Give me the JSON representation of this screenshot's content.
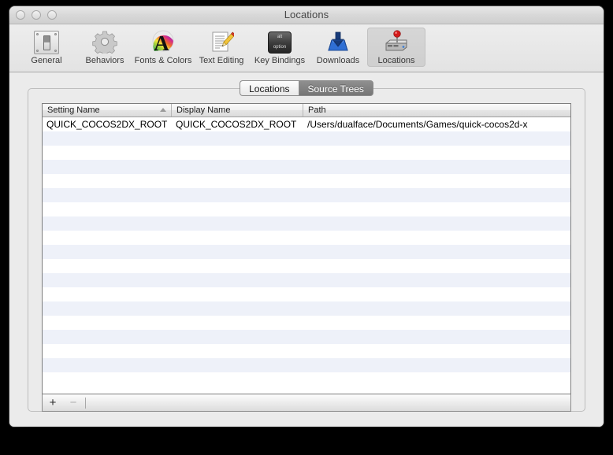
{
  "window": {
    "title": "Locations",
    "traffic_lights": [
      "close-button",
      "minimize-button",
      "zoom-button"
    ]
  },
  "toolbar": {
    "items": [
      {
        "label": "General",
        "icon": "toggle-switch-icon",
        "selected": false
      },
      {
        "label": "Behaviors",
        "icon": "gear-icon",
        "selected": false
      },
      {
        "label": "Fonts & Colors",
        "icon": "rainbow-letter-a-icon",
        "selected": false
      },
      {
        "label": "Text Editing",
        "icon": "document-pencil-icon",
        "selected": false
      },
      {
        "label": "Key Bindings",
        "icon": "option-key-icon",
        "selected": false
      },
      {
        "label": "Downloads",
        "icon": "download-tray-icon",
        "selected": false
      },
      {
        "label": "Locations",
        "icon": "hard-drive-pin-icon",
        "selected": true
      }
    ],
    "key_icon": {
      "top_text": "alt",
      "bottom_text": "option"
    }
  },
  "tabs": {
    "items": [
      {
        "label": "Locations",
        "selected": false
      },
      {
        "label": "Source Trees",
        "selected": true
      }
    ]
  },
  "table": {
    "columns": [
      {
        "label": "Setting Name",
        "sort": "ascending"
      },
      {
        "label": "Display Name",
        "sort": "none"
      },
      {
        "label": "Path",
        "sort": "none"
      }
    ],
    "rows": [
      {
        "setting_name": "QUICK_COCOS2DX_ROOT",
        "display_name": "QUICK_COCOS2DX_ROOT",
        "path": "/Users/dualface/Documents/Games/quick-cocos2d-x"
      }
    ],
    "empty_row_count": 18
  },
  "bottom_bar": {
    "add_label": "+",
    "remove_label": "−",
    "add_enabled": true,
    "remove_enabled": false
  },
  "colors": {
    "window_bg": "#ebebeb",
    "row_stripe": "#eef1f9",
    "tab_selected_bg": "#7e7e7e",
    "pin_red": "#d31b1b",
    "downloads_blue": "#2f6fd4"
  }
}
